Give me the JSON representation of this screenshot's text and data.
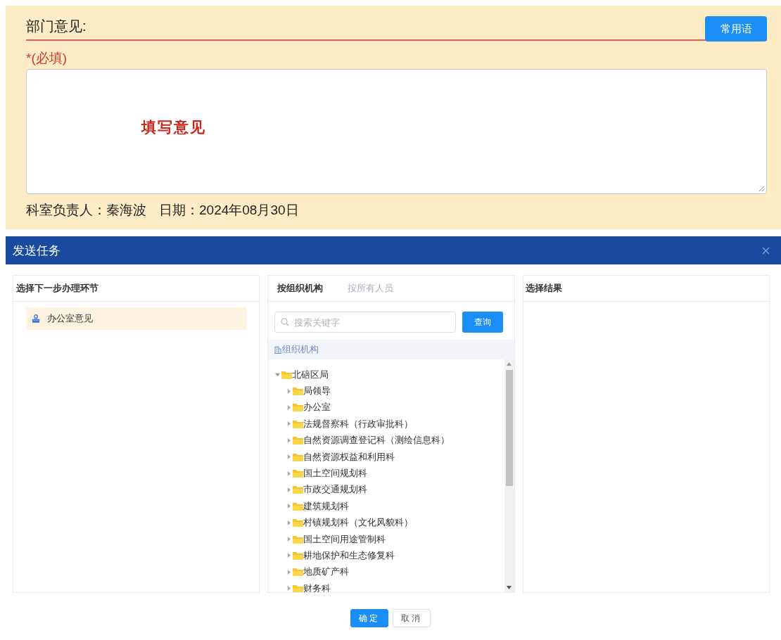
{
  "opinion_form": {
    "label": "部门意见:",
    "phrases_button": "常用语",
    "required_note": "*(必填)",
    "opinion_value": "填写意见",
    "signer": "科室负责人：秦海波",
    "date": "日期：2024年08月30日"
  },
  "dialog": {
    "title": "发送任务",
    "step_panel": {
      "title": "选择下一步办理环节",
      "items": [
        {
          "label": "办公室意见",
          "selected": true
        }
      ]
    },
    "org_panel": {
      "tabs": [
        {
          "label": "按组织机构",
          "selected": true
        },
        {
          "label": "按所有人员",
          "selected": false
        }
      ],
      "search": {
        "placeholder": "搜索关键字"
      },
      "search_button": "查询",
      "root_label": "组织机构",
      "tree": [
        {
          "label": "北碚区局",
          "expanded": true,
          "children": [
            {
              "label": "局领导",
              "expanded": false
            },
            {
              "label": "办公室",
              "expanded": false
            },
            {
              "label": "法规督察科（行政审批科）",
              "expanded": false
            },
            {
              "label": "自然资源调查登记科（测绘信息科）",
              "expanded": false
            },
            {
              "label": "自然资源权益和利用科",
              "expanded": false
            },
            {
              "label": "国土空间规划科",
              "expanded": false
            },
            {
              "label": "市政交通规划科",
              "expanded": false
            },
            {
              "label": "建筑规划科",
              "expanded": false
            },
            {
              "label": "村镇规划科（文化风貌科）",
              "expanded": false
            },
            {
              "label": "国土空间用途管制科",
              "expanded": false
            },
            {
              "label": "耕地保护和生态修复科",
              "expanded": false
            },
            {
              "label": "地质矿产科",
              "expanded": false
            },
            {
              "label": "财务科",
              "expanded": false
            }
          ]
        }
      ]
    },
    "result_panel": {
      "title": "选择结果"
    },
    "buttons": [
      {
        "label": "确定",
        "kind": "primary"
      },
      {
        "label": "取消",
        "kind": "default"
      }
    ]
  }
}
